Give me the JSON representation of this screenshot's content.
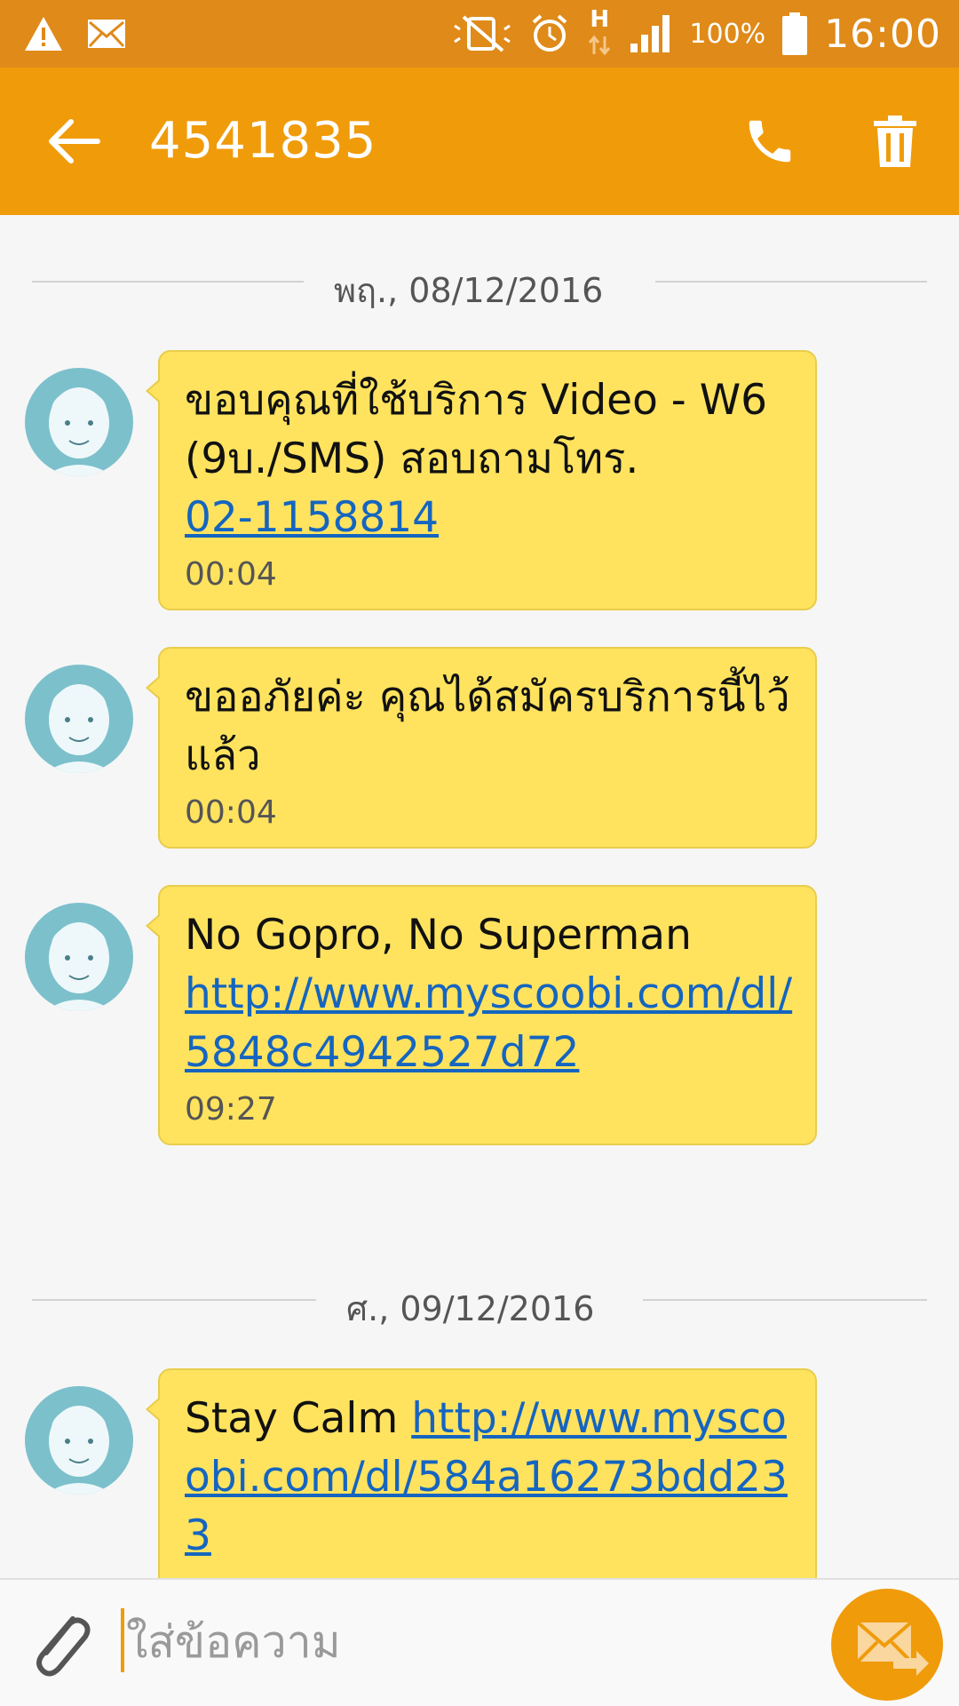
{
  "status_bar": {
    "battery_text": "100%",
    "clock": "16:00",
    "network": "H",
    "icons": [
      "warning-icon",
      "mail-icon",
      "mute-icon",
      "alarm-icon",
      "data-arrows-icon",
      "signal-icon",
      "battery-icon"
    ]
  },
  "app_bar": {
    "title": "4541835",
    "icons": [
      "back-arrow-icon",
      "phone-icon",
      "trash-icon"
    ]
  },
  "dividers": [
    {
      "label": "พฤ., 08/12/2016"
    },
    {
      "label": "ศ., 09/12/2016"
    }
  ],
  "messages": [
    {
      "text": "ขอบคุณที่ใช้บริการ Video - W6 (9บ./SMS) สอบถามโทร.",
      "link": "02-1158814",
      "time": "00:04"
    },
    {
      "text": "ขออภัยค่ะ คุณได้สมัครบริการนี้ไว้แล้ว",
      "time": "00:04"
    },
    {
      "text": "No Gopro, No Superman",
      "link": "http://www.myscoobi.com/dl/5848c4942527d72",
      "time": "09:27"
    },
    {
      "text": "Stay Calm",
      "link": "http://www.myscoobi.com/dl/584a16273bdd233"
    }
  ],
  "compose": {
    "placeholder": "ใส่ข้อความ"
  },
  "colors": {
    "status_bar": "#df8a19",
    "app_bar": "#f09b0a",
    "bubble": "#ffe35f",
    "link": "#1565c0",
    "avatar": "#7cc0cc"
  }
}
